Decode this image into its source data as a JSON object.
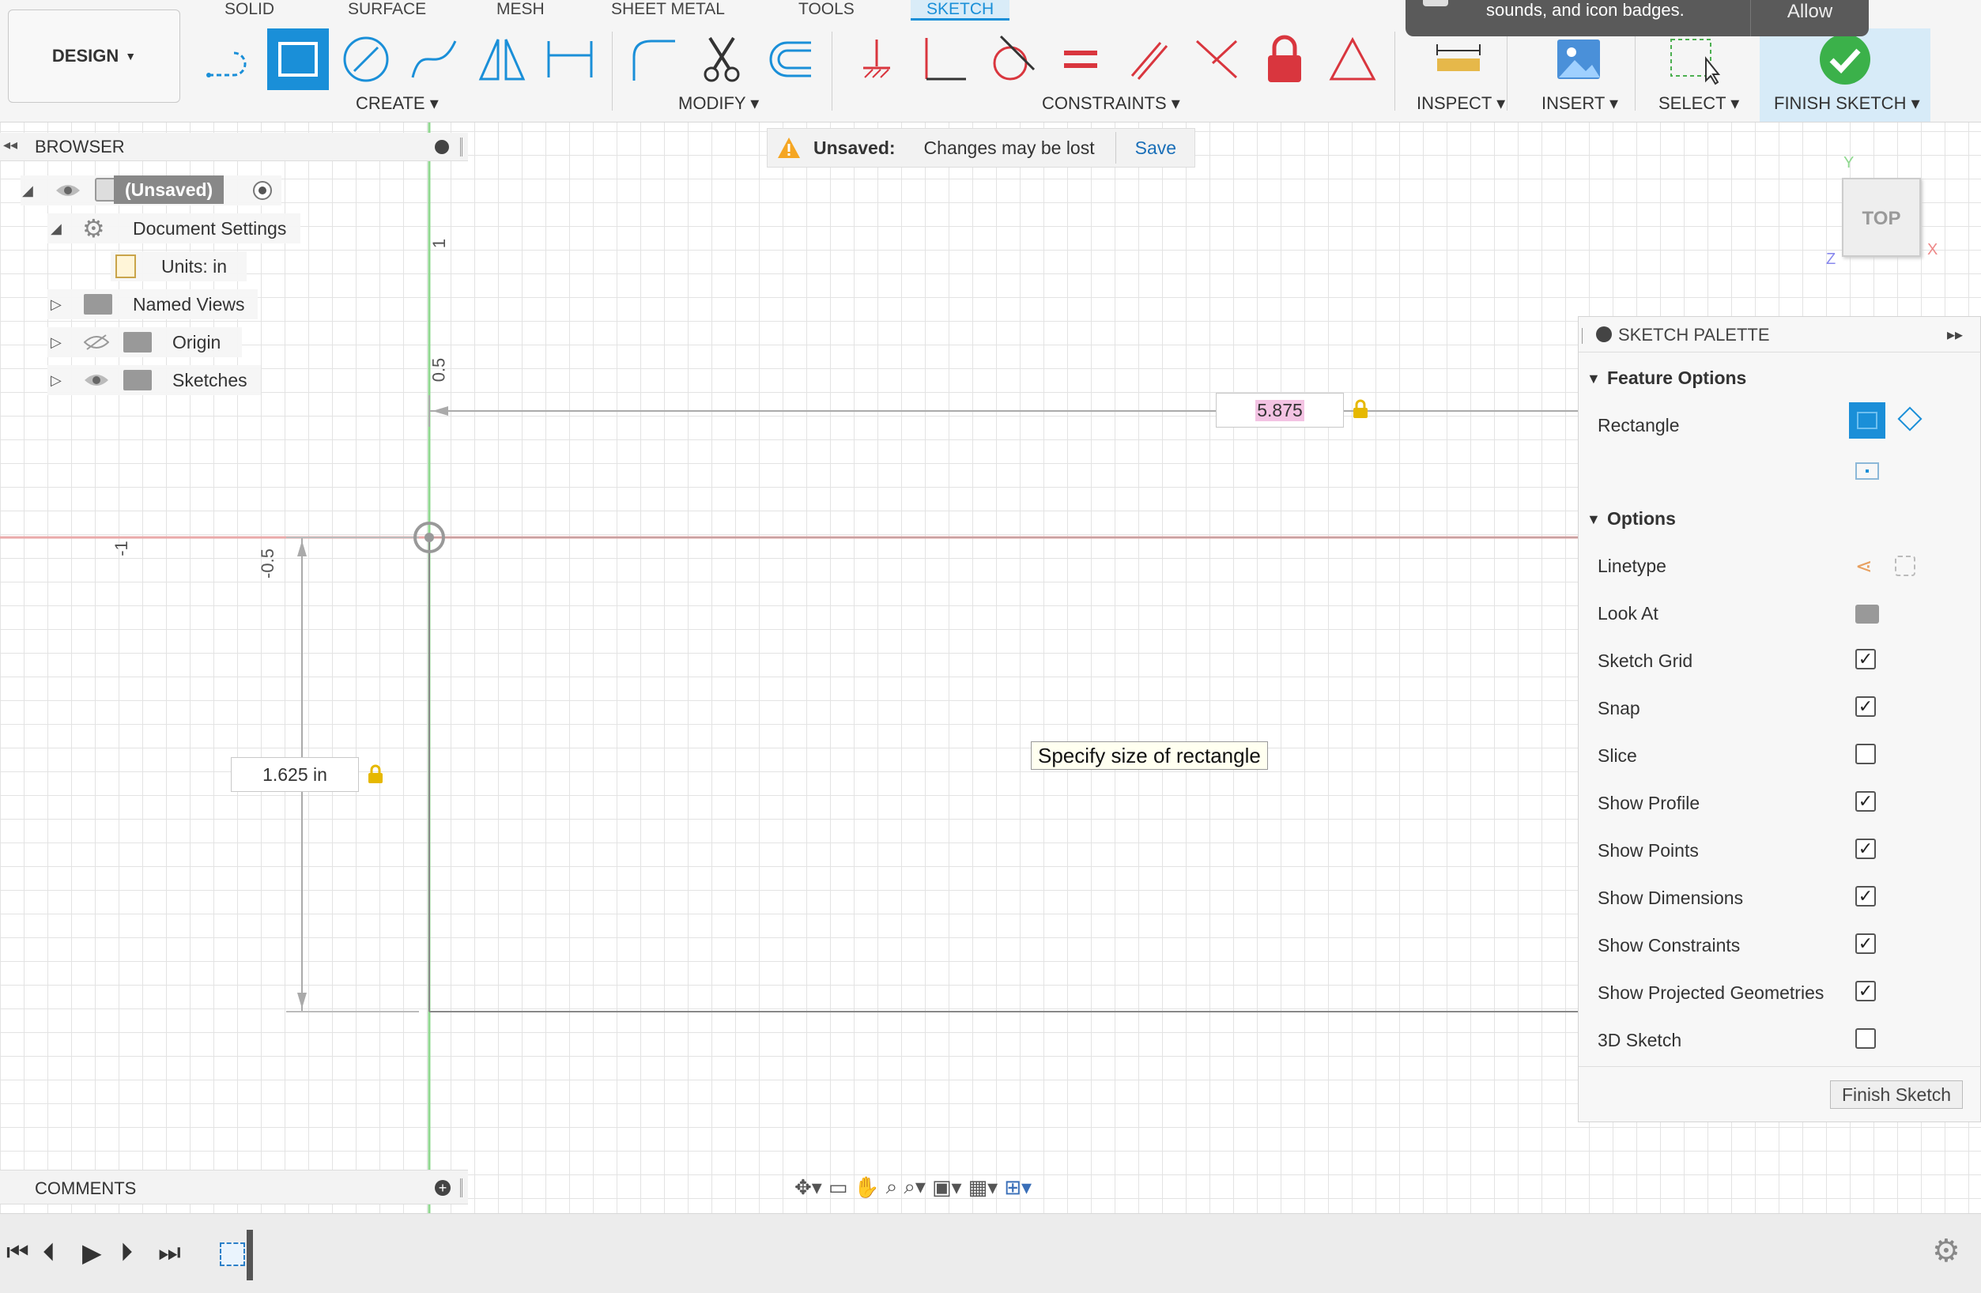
{
  "workspace": {
    "label": "DESIGN"
  },
  "tabs": [
    {
      "label": "SOLID"
    },
    {
      "label": "SURFACE"
    },
    {
      "label": "MESH"
    },
    {
      "label": "SHEET METAL"
    },
    {
      "label": "TOOLS"
    },
    {
      "label": "SKETCH",
      "active": true
    }
  ],
  "groups": {
    "create": "CREATE ▾",
    "modify": "MODIFY ▾",
    "constraints": "CONSTRAINTS ▾",
    "inspect": "INSPECT ▾",
    "insert": "INSERT ▾",
    "select": "SELECT ▾",
    "finish": "FINISH SKETCH ▾"
  },
  "notification": {
    "text": "sounds, and icon badges.",
    "allow": "Allow"
  },
  "browser": {
    "title": "BROWSER",
    "root": "(Unsaved)",
    "items": [
      {
        "label": "Document Settings"
      },
      {
        "label": "Units: in"
      },
      {
        "label": "Named Views"
      },
      {
        "label": "Origin"
      },
      {
        "label": "Sketches"
      }
    ]
  },
  "unsaved": {
    "label": "Unsaved:",
    "message": "Changes may be lost",
    "save": "Save"
  },
  "viewcube": {
    "face": "TOP",
    "x": "X",
    "y": "Y",
    "z": "Z"
  },
  "canvas": {
    "width_value": "5.875",
    "height_value": "1.625 in",
    "tooltip": "Specify size of rectangle",
    "axis_labels": [
      "1",
      "0.5",
      "-0.5",
      "-1"
    ]
  },
  "palette": {
    "title": "SKETCH PALETTE",
    "feature_options": "Feature Options",
    "rectangle": "Rectangle",
    "options": "Options",
    "rows": [
      {
        "label": "Linetype",
        "kind": "icon"
      },
      {
        "label": "Look At",
        "kind": "icon"
      },
      {
        "label": "Sketch Grid",
        "checked": true
      },
      {
        "label": "Snap",
        "checked": true
      },
      {
        "label": "Slice",
        "checked": false
      },
      {
        "label": "Show Profile",
        "checked": true
      },
      {
        "label": "Show Points",
        "checked": true
      },
      {
        "label": "Show Dimensions",
        "checked": true
      },
      {
        "label": "Show Constraints",
        "checked": true
      },
      {
        "label": "Show Projected Geometries",
        "checked": true
      },
      {
        "label": "3D Sketch",
        "checked": false
      }
    ],
    "finish_button": "Finish Sketch"
  },
  "comments": {
    "title": "COMMENTS"
  },
  "colors": {
    "accent": "#1a8fd8",
    "constraint_red": "#d9363e",
    "axis_green": "#7cd07c",
    "axis_red": "#e89a9a"
  }
}
